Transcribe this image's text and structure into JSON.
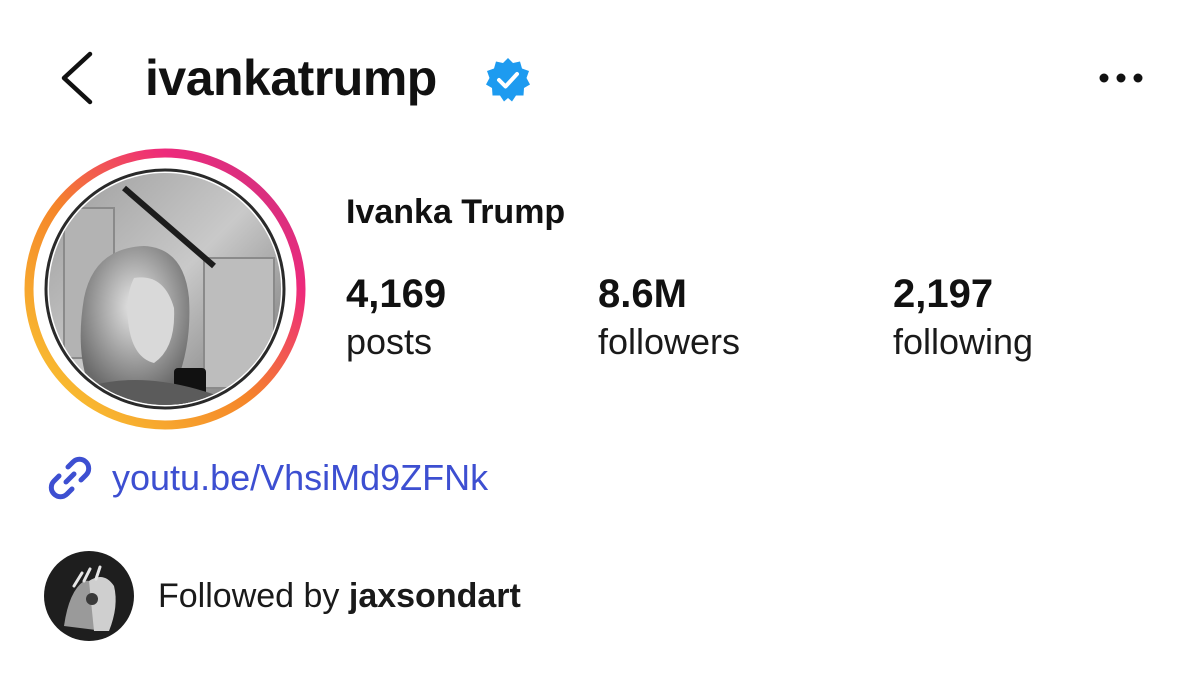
{
  "header": {
    "username": "ivankatrump",
    "verified_icon": "verified-badge-icon",
    "back_icon": "chevron-left-icon",
    "more_icon": "more-horizontal-icon",
    "accent_color": "#1d9bf0"
  },
  "profile": {
    "display_name": "Ivanka Trump",
    "stats": {
      "posts": {
        "value": "4,169",
        "label": "posts"
      },
      "followers": {
        "value": "8.6M",
        "label": "followers"
      },
      "following": {
        "value": "2,197",
        "label": "following"
      }
    },
    "story_ring_colors": [
      "#f9ce34",
      "#ee2a7b",
      "#c13584"
    ]
  },
  "bio": {
    "link_icon": "link-icon",
    "link_text": "youtu.be/VhsiMd9ZFNk",
    "link_color": "#3d4fd1"
  },
  "followed_by": {
    "prefix": "Followed by ",
    "username": "jaxsondart"
  }
}
